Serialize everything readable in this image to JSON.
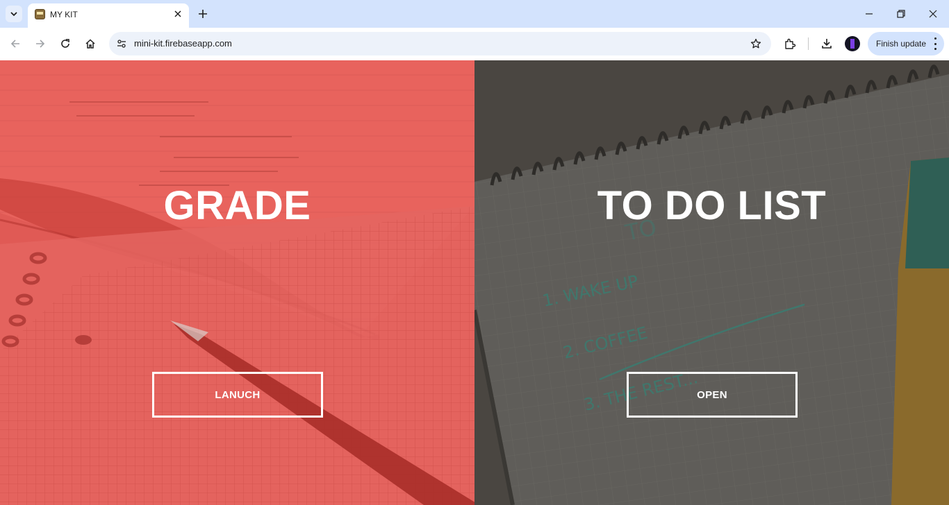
{
  "browser": {
    "tab_title": "MY KIT",
    "url": "mini-kit.firebaseapp.com",
    "finish_update_label": "Finish update",
    "icons": [
      "tab-search-icon",
      "close-icon",
      "plus-icon",
      "minimize-icon",
      "restore-icon",
      "close-window-icon",
      "back-arrow-icon",
      "forward-arrow-icon",
      "reload-icon",
      "home-icon",
      "site-settings-icon",
      "star-icon",
      "extensions-icon",
      "download-icon",
      "more-vert-icon"
    ]
  },
  "panels": {
    "grade": {
      "title": "GRADE",
      "button_label": "LANUCH",
      "color": "#e05a55"
    },
    "todo": {
      "title": "TO DO LIST",
      "button_label": "OPEN",
      "color": "#55524e"
    }
  },
  "todo_notepad": {
    "heading": "TO",
    "items": [
      "1. WAKE UP",
      "2. COFFEE",
      "3. THE REST..."
    ]
  }
}
